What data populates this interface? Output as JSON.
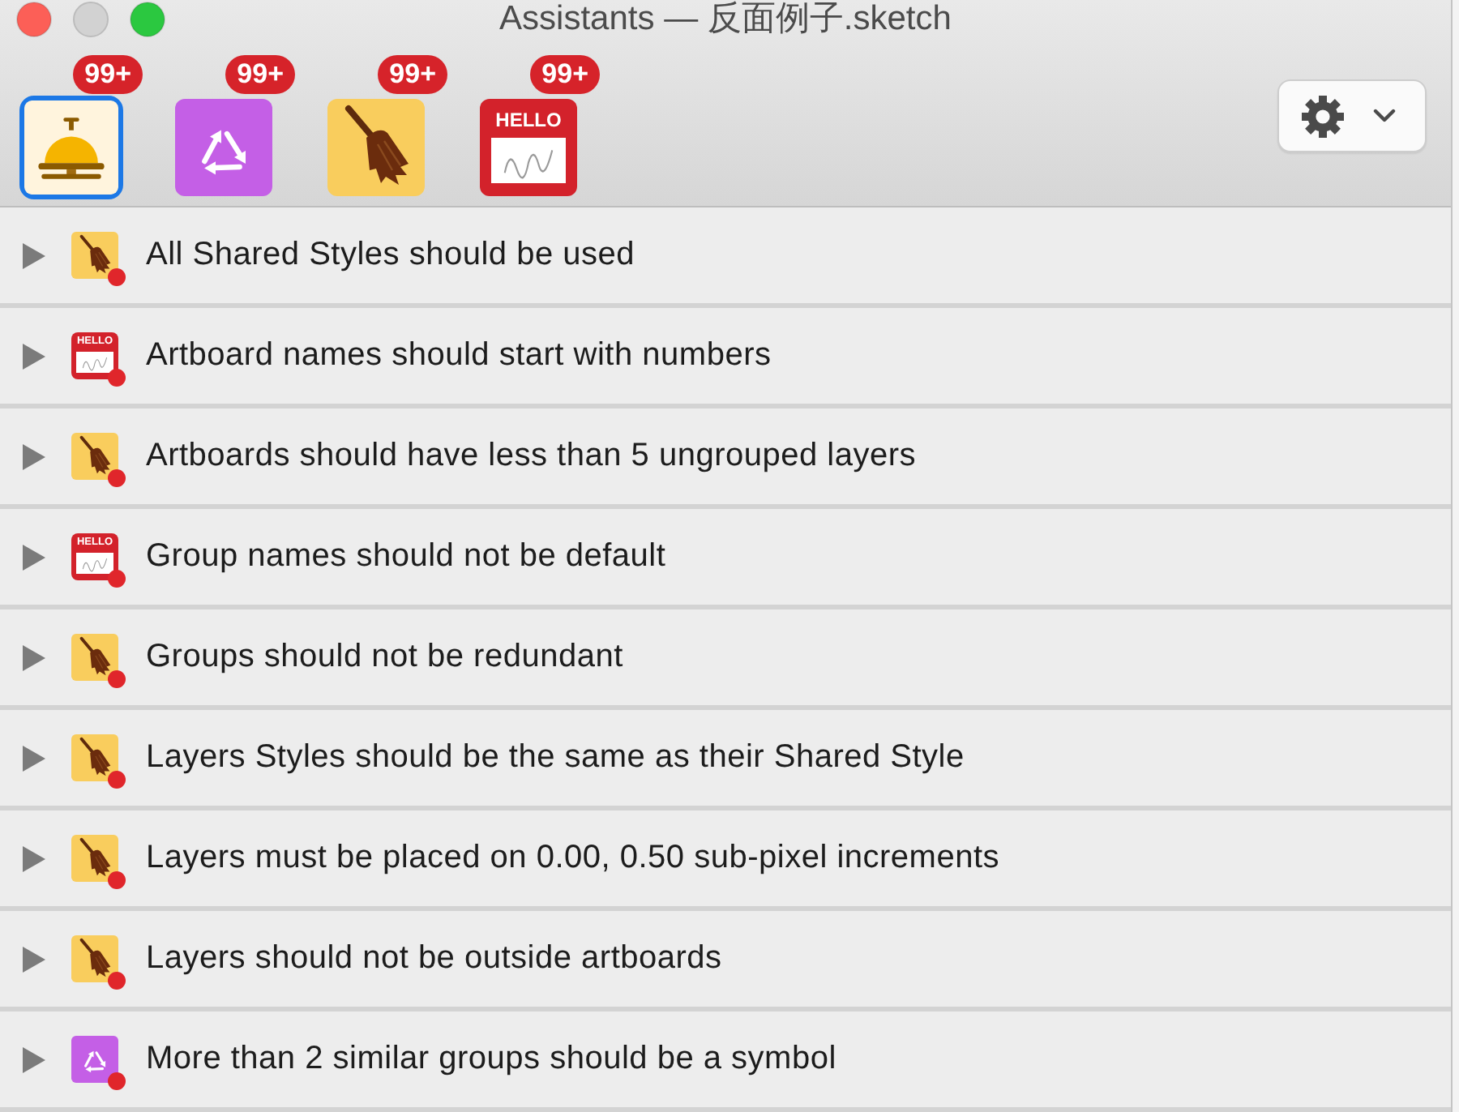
{
  "window": {
    "controls": [
      {
        "kind": "close",
        "disabled": false
      },
      {
        "kind": "minimize",
        "disabled": true
      },
      {
        "kind": "zoom",
        "disabled": false
      }
    ],
    "title": "Assistants — 反面例子.sketch"
  },
  "toolbar": {
    "assistants": [
      {
        "kind": "bell",
        "selected": true,
        "badge": "99+"
      },
      {
        "kind": "recycle",
        "selected": false,
        "badge": "99+"
      },
      {
        "kind": "broom",
        "selected": false,
        "badge": "99+"
      },
      {
        "kind": "hello",
        "icon_text": "HELLO",
        "selected": false,
        "badge": "99+"
      }
    ]
  },
  "rules": [
    {
      "kind": "broom",
      "error": true,
      "expanded": false,
      "label": "All Shared Styles should be used"
    },
    {
      "kind": "hello",
      "icon_text": "HELLO",
      "error": true,
      "expanded": false,
      "label": "Artboard names should start with numbers"
    },
    {
      "kind": "broom",
      "error": true,
      "expanded": false,
      "label": "Artboards should have less than 5 ungrouped layers"
    },
    {
      "kind": "hello",
      "icon_text": "HELLO",
      "error": true,
      "expanded": false,
      "label": "Group names should not be default"
    },
    {
      "kind": "broom",
      "error": true,
      "expanded": false,
      "label": "Groups should not be redundant"
    },
    {
      "kind": "broom",
      "error": true,
      "expanded": false,
      "label": "Layers Styles should be the same as their Shared Style"
    },
    {
      "kind": "broom",
      "error": true,
      "expanded": false,
      "label": "Layers must be placed on 0.00, 0.50 sub-pixel increments"
    },
    {
      "kind": "broom",
      "error": true,
      "expanded": false,
      "label": "Layers should not be outside artboards"
    },
    {
      "kind": "recycle",
      "error": true,
      "expanded": false,
      "label": "More than 2 similar groups should be a symbol"
    }
  ]
}
